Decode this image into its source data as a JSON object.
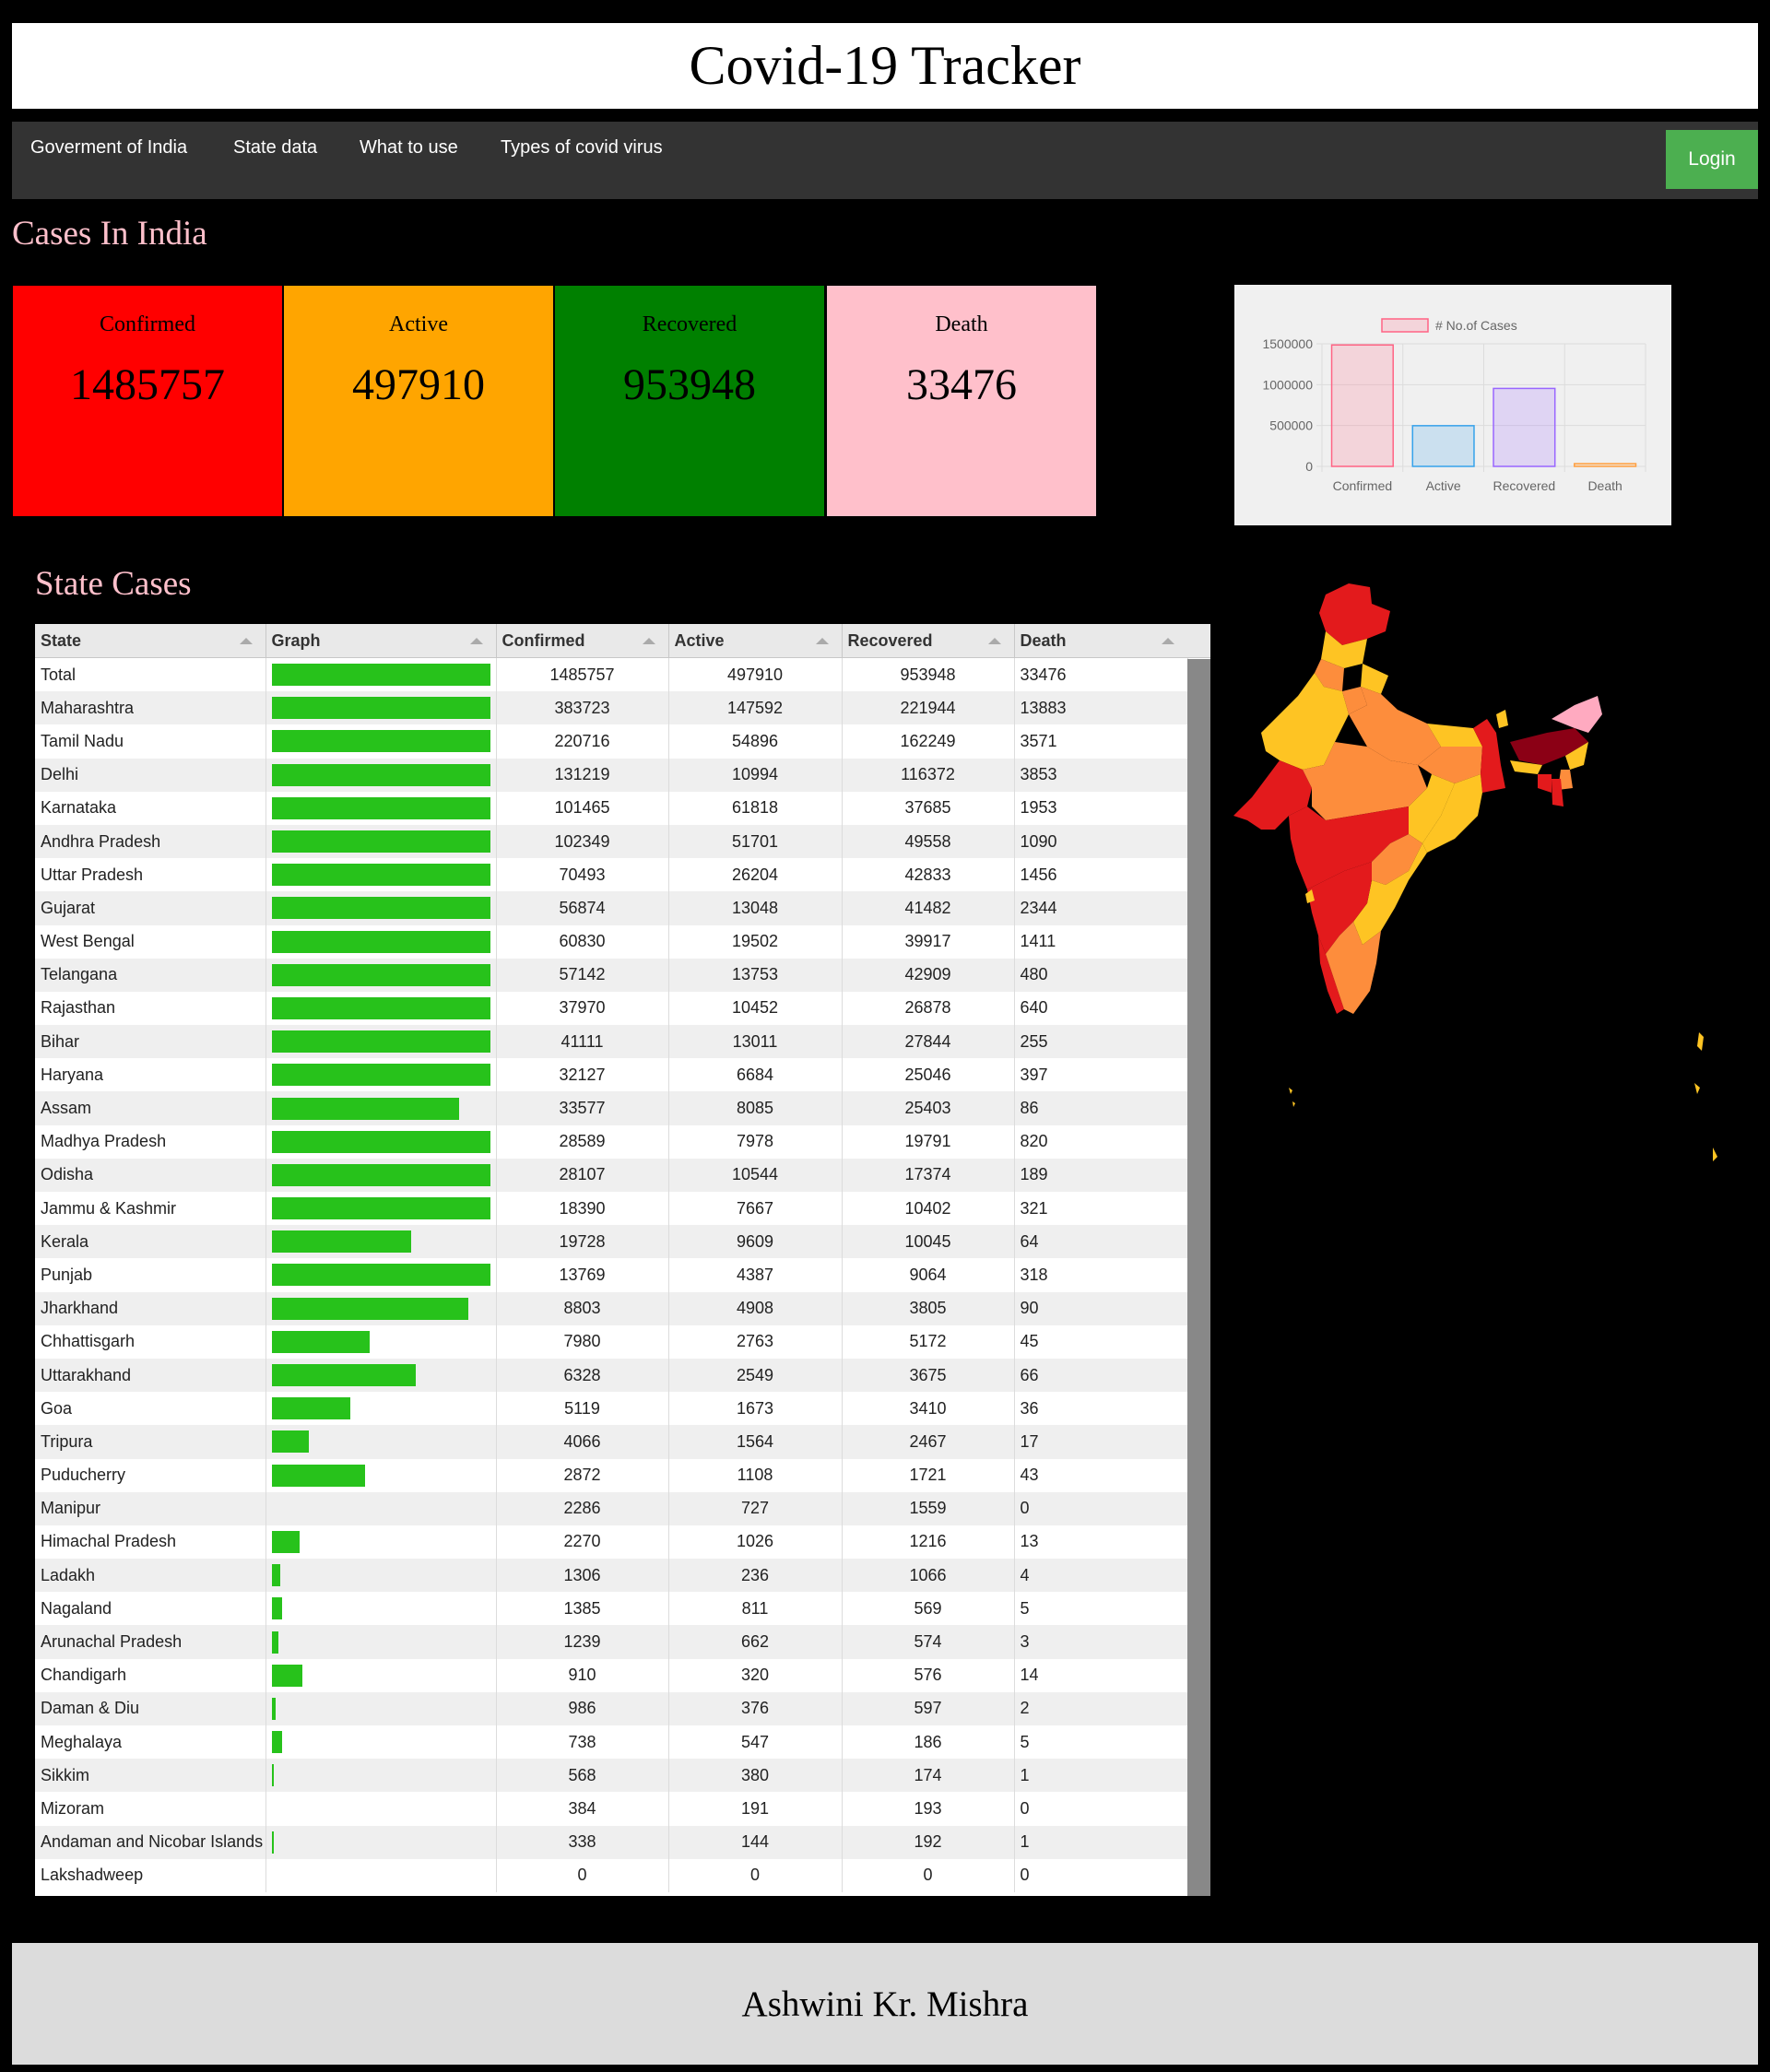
{
  "header": {
    "title": "Covid-19 Tracker"
  },
  "nav": {
    "items": [
      "Goverment of India",
      "State data",
      "What to use",
      "Types of covid virus"
    ],
    "login_label": "Login"
  },
  "cases_section": {
    "title": "Cases In India"
  },
  "cards": [
    {
      "label": "Confirmed",
      "value": "1485757",
      "color": "#ff0000"
    },
    {
      "label": "Active",
      "value": "497910",
      "color": "#ffa500"
    },
    {
      "label": "Recovered",
      "value": "953948",
      "color": "#008000"
    },
    {
      "label": "Death",
      "value": "33476",
      "color": "#ffc0cb"
    }
  ],
  "chart_data": {
    "type": "bar",
    "categories": [
      "Confirmed",
      "Active",
      "Recovered",
      "Death"
    ],
    "series": [
      {
        "name": "# No.of Cases",
        "values": [
          1485757,
          497910,
          953948,
          33476
        ]
      }
    ],
    "colors": [
      "rgba(255,99,132,0.2)",
      "rgba(54,162,235,0.2)",
      "rgba(153,102,255,0.2)",
      "rgba(255,159,64,0.2)"
    ],
    "border_colors": [
      "#ff6384",
      "#36a2eb",
      "#9966ff",
      "#ff9f40"
    ],
    "ylim": [
      0,
      1500000
    ],
    "yticks": [
      "1500000",
      "1000000",
      "500000",
      "0"
    ],
    "legend": "top",
    "grid": true
  },
  "state_section": {
    "title": "State Cases"
  },
  "table": {
    "columns": [
      "State",
      "Graph",
      "Confirmed",
      "Active",
      "Recovered",
      "Death"
    ],
    "rows": [
      [
        "Total",
        "1485757",
        "497910",
        "953948",
        "33476"
      ],
      [
        "Maharashtra",
        "383723",
        "147592",
        "221944",
        "13883"
      ],
      [
        "Tamil Nadu",
        "220716",
        "54896",
        "162249",
        "3571"
      ],
      [
        "Delhi",
        "131219",
        "10994",
        "116372",
        "3853"
      ],
      [
        "Karnataka",
        "101465",
        "61818",
        "37685",
        "1953"
      ],
      [
        "Andhra Pradesh",
        "102349",
        "51701",
        "49558",
        "1090"
      ],
      [
        "Uttar Pradesh",
        "70493",
        "26204",
        "42833",
        "1456"
      ],
      [
        "Gujarat",
        "56874",
        "13048",
        "41482",
        "2344"
      ],
      [
        "West Bengal",
        "60830",
        "19502",
        "39917",
        "1411"
      ],
      [
        "Telangana",
        "57142",
        "13753",
        "42909",
        "480"
      ],
      [
        "Rajasthan",
        "37970",
        "10452",
        "26878",
        "640"
      ],
      [
        "Bihar",
        "41111",
        "13011",
        "27844",
        "255"
      ],
      [
        "Haryana",
        "32127",
        "6684",
        "25046",
        "397"
      ],
      [
        "Assam",
        "33577",
        "8085",
        "25403",
        "86"
      ],
      [
        "Madhya Pradesh",
        "28589",
        "7978",
        "19791",
        "820"
      ],
      [
        "Odisha",
        "28107",
        "10544",
        "17374",
        "189"
      ],
      [
        "Jammu & Kashmir",
        "18390",
        "7667",
        "10402",
        "321"
      ],
      [
        "Kerala",
        "19728",
        "9609",
        "10045",
        "64"
      ],
      [
        "Punjab",
        "13769",
        "4387",
        "9064",
        "318"
      ],
      [
        "Jharkhand",
        "8803",
        "4908",
        "3805",
        "90"
      ],
      [
        "Chhattisgarh",
        "7980",
        "2763",
        "5172",
        "45"
      ],
      [
        "Uttarakhand",
        "6328",
        "2549",
        "3675",
        "66"
      ],
      [
        "Goa",
        "5119",
        "1673",
        "3410",
        "36"
      ],
      [
        "Tripura",
        "4066",
        "1564",
        "2467",
        "17"
      ],
      [
        "Puducherry",
        "2872",
        "1108",
        "1721",
        "43"
      ],
      [
        "Manipur",
        "2286",
        "727",
        "1559",
        "0"
      ],
      [
        "Himachal Pradesh",
        "2270",
        "1026",
        "1216",
        "13"
      ],
      [
        "Ladakh",
        "1306",
        "236",
        "1066",
        "4"
      ],
      [
        "Nagaland",
        "1385",
        "811",
        "569",
        "5"
      ],
      [
        "Arunachal Pradesh",
        "1239",
        "662",
        "574",
        "3"
      ],
      [
        "Chandigarh",
        "910",
        "320",
        "576",
        "14"
      ],
      [
        "Daman & Diu",
        "986",
        "376",
        "597",
        "2"
      ],
      [
        "Meghalaya",
        "738",
        "547",
        "186",
        "5"
      ],
      [
        "Sikkim",
        "568",
        "380",
        "174",
        "1"
      ],
      [
        "Mizoram",
        "384",
        "191",
        "193",
        "0"
      ],
      [
        "Andaman and Nicobar Islands",
        "338",
        "144",
        "192",
        "1"
      ],
      [
        "Lakshadweep",
        "0",
        "0",
        "0",
        "0"
      ]
    ],
    "graph_fraction": [
      1,
      1,
      1,
      1,
      1,
      1,
      1,
      1,
      1,
      1,
      1,
      1,
      1,
      0.86,
      1,
      1,
      1,
      0.64,
      1,
      0.9,
      0.45,
      0.66,
      0.36,
      0.17,
      0.43,
      0,
      0.13,
      0.04,
      0.05,
      0.03,
      0.14,
      0.02,
      0.05,
      0.01,
      0,
      0.01,
      0
    ]
  },
  "footer": {
    "author": "Ashwini Kr. Mishra"
  }
}
